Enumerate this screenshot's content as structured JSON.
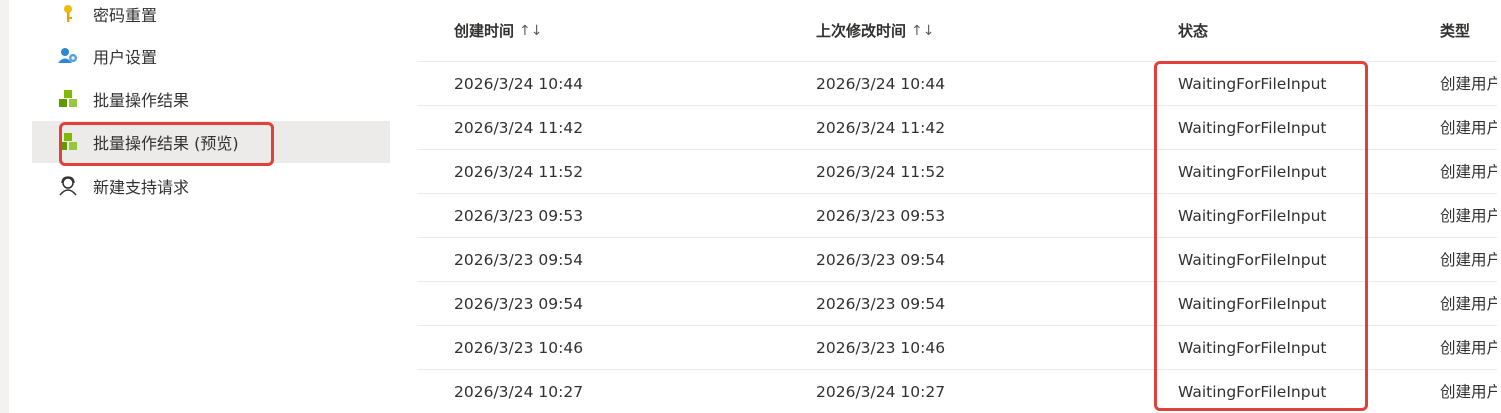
{
  "sidebar": {
    "items": [
      {
        "label": "密码重置",
        "icon": "key-icon"
      },
      {
        "label": "用户设置",
        "icon": "user-settings-icon"
      },
      {
        "label": "批量操作结果",
        "icon": "bulk-operations-icon"
      },
      {
        "label": "批量操作结果 (预览)",
        "icon": "bulk-operations-icon",
        "selected": true
      },
      {
        "label": "新建支持请求",
        "icon": "support-person-icon"
      }
    ]
  },
  "table": {
    "columns": [
      {
        "label": "创建时间",
        "sortable": true,
        "sort_icon": "↑↓"
      },
      {
        "label": "上次修改时间",
        "sortable": true,
        "sort_icon": "↑↓"
      },
      {
        "label": "状态",
        "sortable": false
      },
      {
        "label": "类型",
        "sortable": false
      }
    ],
    "rows": [
      {
        "created": "2026/3/24 10:44",
        "modified": "2026/3/24 10:44",
        "status": "WaitingForFileInput",
        "type": "创建用户"
      },
      {
        "created": "2026/3/24 11:42",
        "modified": "2026/3/24 11:42",
        "status": "WaitingForFileInput",
        "type": "创建用户"
      },
      {
        "created": "2026/3/24 11:52",
        "modified": "2026/3/24 11:52",
        "status": "WaitingForFileInput",
        "type": "创建用户"
      },
      {
        "created": "2026/3/23 09:53",
        "modified": "2026/3/23 09:53",
        "status": "WaitingForFileInput",
        "type": "创建用户"
      },
      {
        "created": "2026/3/23 09:54",
        "modified": "2026/3/23 09:54",
        "status": "WaitingForFileInput",
        "type": "创建用户"
      },
      {
        "created": "2026/3/23 09:54",
        "modified": "2026/3/23 09:54",
        "status": "WaitingForFileInput",
        "type": "创建用户"
      },
      {
        "created": "2026/3/23 10:46",
        "modified": "2026/3/23 10:46",
        "status": "WaitingForFileInput",
        "type": "创建用户"
      },
      {
        "created": "2026/3/24 10:27",
        "modified": "2026/3/24 10:27",
        "status": "WaitingForFileInput",
        "type": "创建用户"
      }
    ]
  },
  "colors": {
    "highlight": "#e0413b",
    "selected_bg": "#edebe9",
    "key_icon": "#f2b90c",
    "user_icon": "#2b88d8",
    "bulk_icon": "#7fba00"
  }
}
